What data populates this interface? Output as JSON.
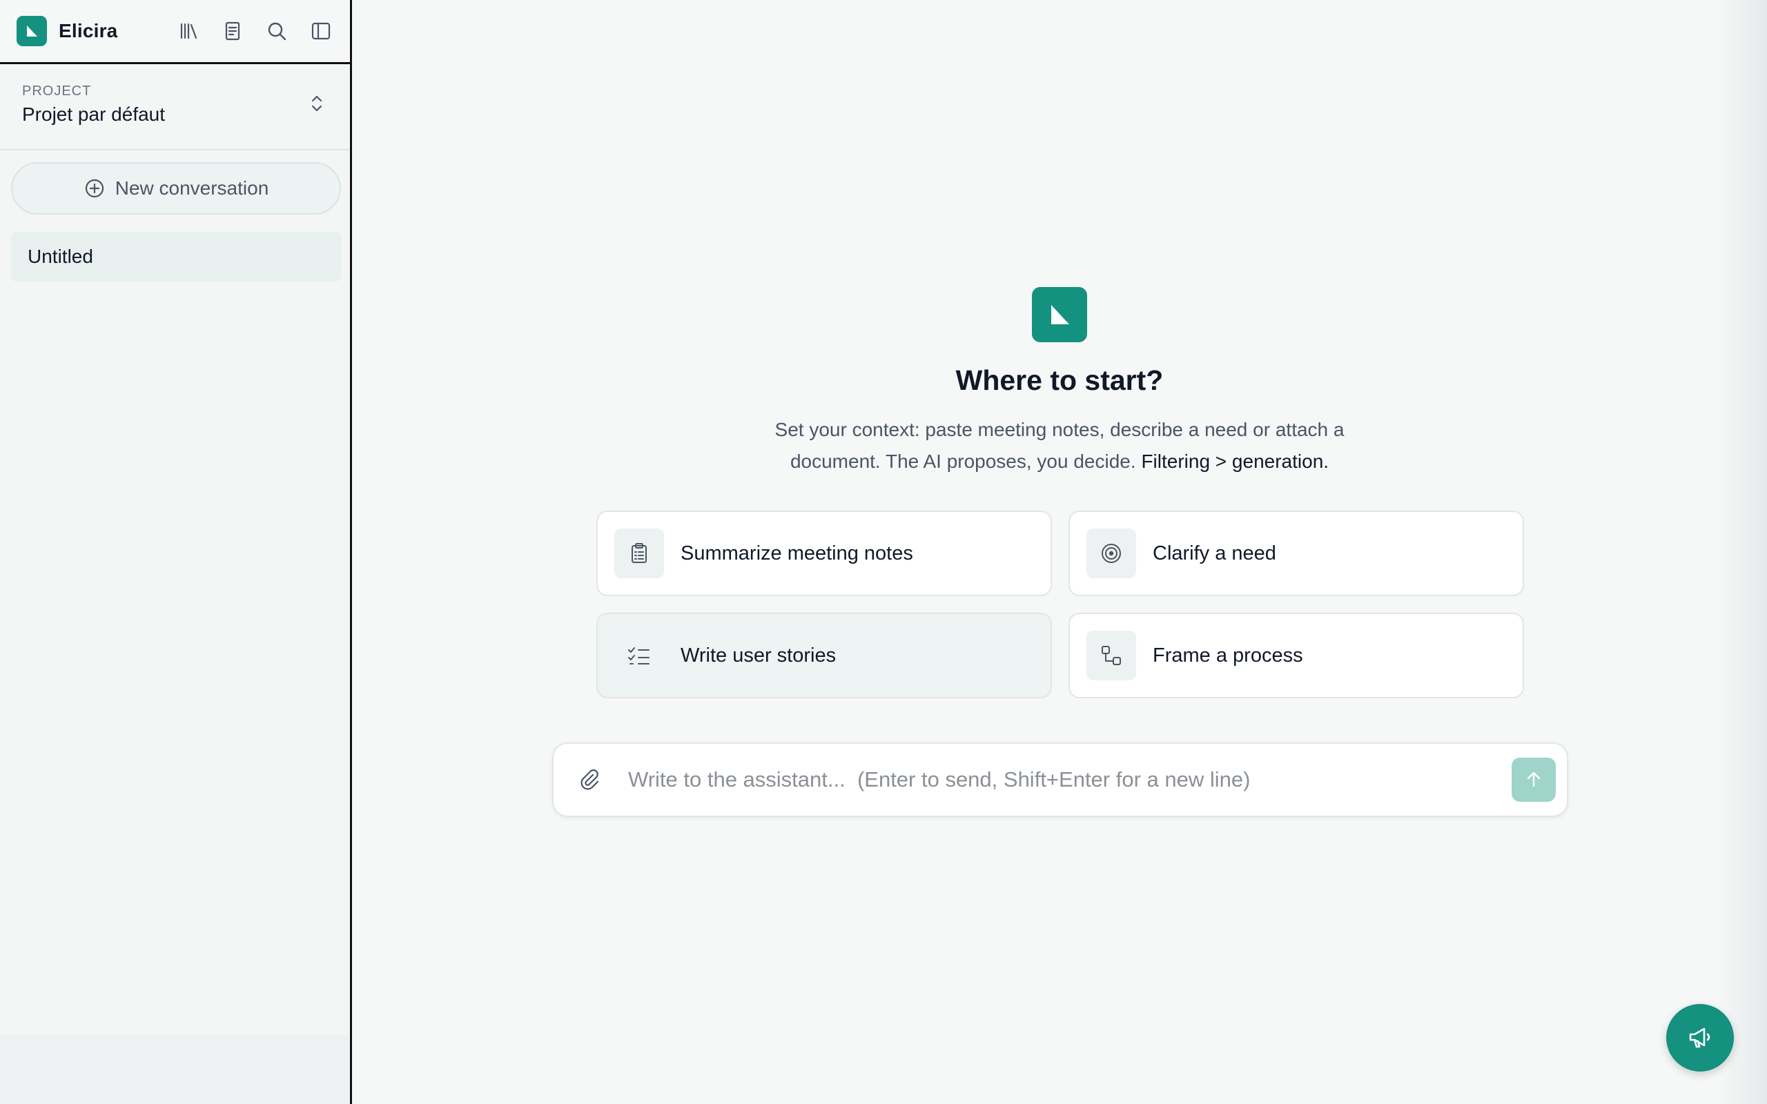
{
  "app": {
    "name": "Elicira",
    "brand_color": "#14917f"
  },
  "sidebar": {
    "tools": [
      {
        "icon": "library-icon"
      },
      {
        "icon": "book-icon"
      },
      {
        "icon": "search-icon"
      },
      {
        "icon": "sidebar-toggle-icon"
      }
    ],
    "project": {
      "label": "PROJECT",
      "name": "Projet par défaut"
    },
    "new_conversation_label": "New conversation",
    "conversations": [
      {
        "title": "Untitled",
        "active": true
      }
    ]
  },
  "main": {
    "title": "Where to start?",
    "subtitle": "Set your context: paste meeting notes, describe a need or attach a document. The AI proposes, you decide.",
    "subtitle_emphasis": "Filtering > generation.",
    "cards": [
      {
        "label": "Summarize meeting notes",
        "icon": "clipboard-icon"
      },
      {
        "label": "Clarify a need",
        "icon": "target-icon"
      },
      {
        "label": "Write user stories",
        "icon": "checklist-icon"
      },
      {
        "label": "Frame a process",
        "icon": "process-icon"
      }
    ],
    "composer": {
      "placeholder": "Write to the assistant...  (Enter to send, Shift+Enter for a new line)",
      "value": ""
    }
  },
  "fab": {
    "icon": "megaphone-icon"
  }
}
